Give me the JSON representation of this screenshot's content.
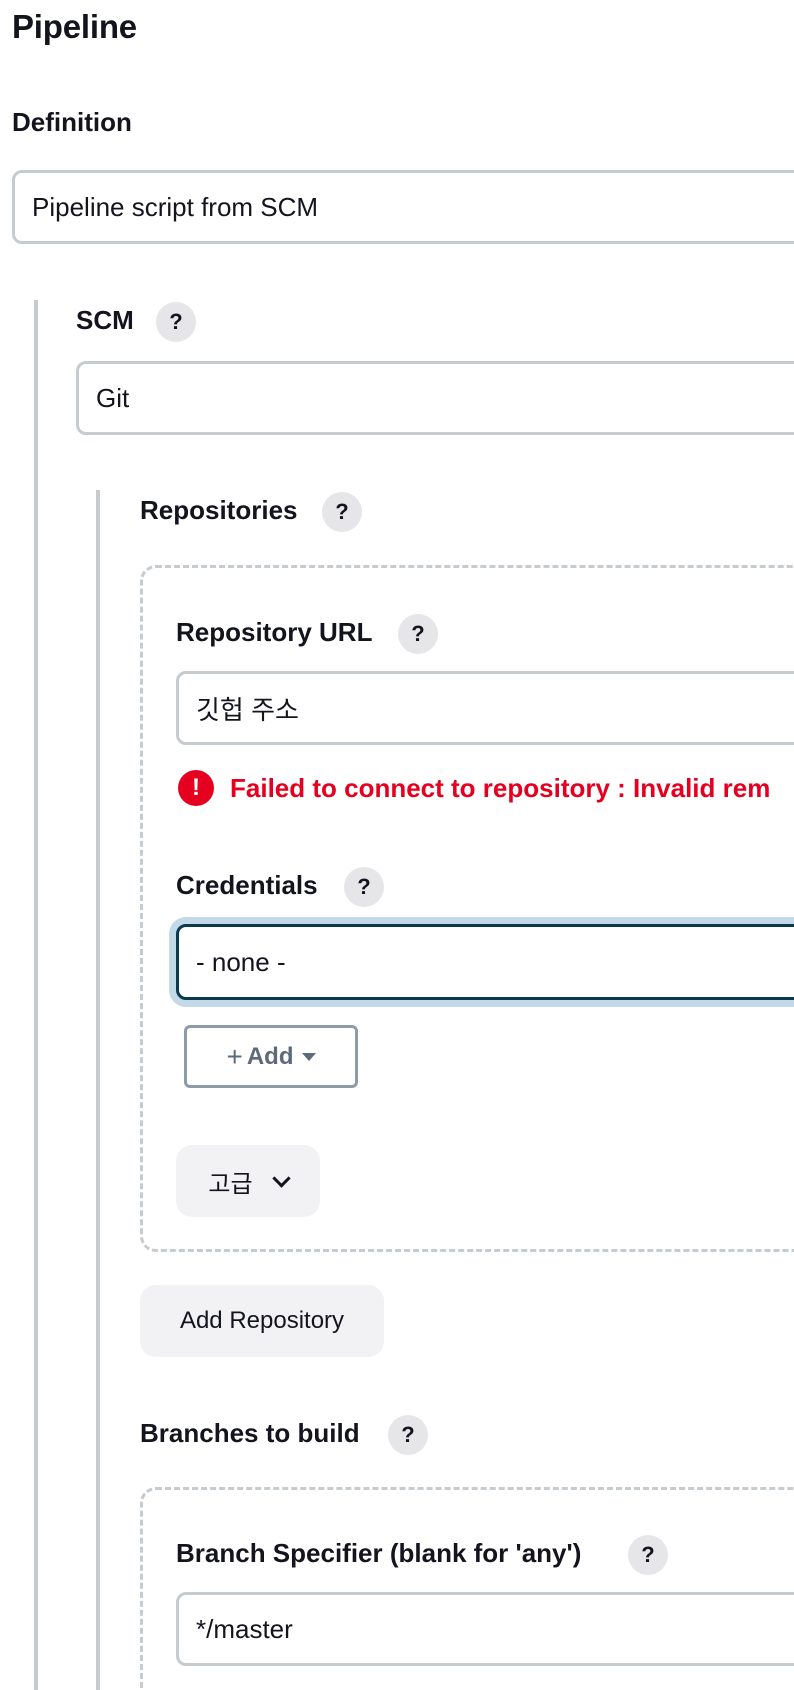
{
  "section": {
    "title": "Pipeline"
  },
  "definition": {
    "label": "Definition",
    "value": "Pipeline script from SCM"
  },
  "scm": {
    "label": "SCM",
    "help": "?",
    "value": "Git"
  },
  "repositories": {
    "label": "Repositories",
    "help": "?",
    "repository_url": {
      "label": "Repository URL",
      "help": "?",
      "value": "깃헙 주소",
      "error_icon": "!",
      "error": "Failed to connect to repository : Invalid rem"
    },
    "credentials": {
      "label": "Credentials",
      "help": "?",
      "value": "- none -",
      "add_plus": "+",
      "add_label": "Add"
    },
    "advanced_label": "고급",
    "add_repository_label": "Add Repository"
  },
  "branches": {
    "label": "Branches to build",
    "help": "?",
    "specifier": {
      "label": "Branch Specifier (blank for 'any')",
      "help": "?",
      "value": "*/master"
    }
  },
  "icons": {
    "help": "question-mark-circle-icon",
    "error": "error-circle-icon",
    "add": "plus-icon",
    "dropdown": "caret-down-icon",
    "expand": "chevron-down-icon"
  },
  "colors": {
    "error": "#e6001f",
    "focus_border": "#0b3950",
    "focus_ring": "#c3d9e7",
    "border": "#c6cbd0"
  }
}
